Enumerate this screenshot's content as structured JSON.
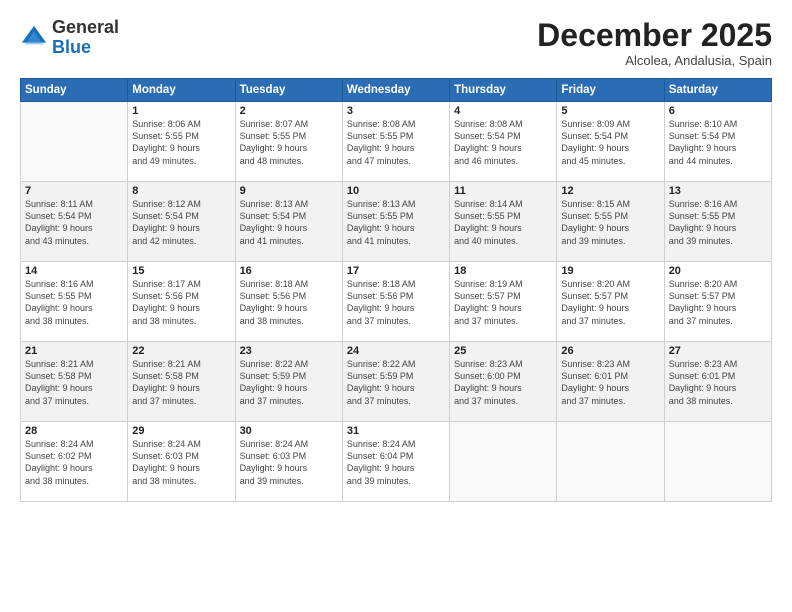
{
  "logo": {
    "general": "General",
    "blue": "Blue"
  },
  "header": {
    "month": "December 2025",
    "location": "Alcolea, Andalusia, Spain"
  },
  "weekdays": [
    "Sunday",
    "Monday",
    "Tuesday",
    "Wednesday",
    "Thursday",
    "Friday",
    "Saturday"
  ],
  "weeks": [
    [
      {
        "day": "",
        "info": ""
      },
      {
        "day": "1",
        "info": "Sunrise: 8:06 AM\nSunset: 5:55 PM\nDaylight: 9 hours\nand 49 minutes."
      },
      {
        "day": "2",
        "info": "Sunrise: 8:07 AM\nSunset: 5:55 PM\nDaylight: 9 hours\nand 48 minutes."
      },
      {
        "day": "3",
        "info": "Sunrise: 8:08 AM\nSunset: 5:55 PM\nDaylight: 9 hours\nand 47 minutes."
      },
      {
        "day": "4",
        "info": "Sunrise: 8:08 AM\nSunset: 5:54 PM\nDaylight: 9 hours\nand 46 minutes."
      },
      {
        "day": "5",
        "info": "Sunrise: 8:09 AM\nSunset: 5:54 PM\nDaylight: 9 hours\nand 45 minutes."
      },
      {
        "day": "6",
        "info": "Sunrise: 8:10 AM\nSunset: 5:54 PM\nDaylight: 9 hours\nand 44 minutes."
      }
    ],
    [
      {
        "day": "7",
        "info": "Sunrise: 8:11 AM\nSunset: 5:54 PM\nDaylight: 9 hours\nand 43 minutes."
      },
      {
        "day": "8",
        "info": "Sunrise: 8:12 AM\nSunset: 5:54 PM\nDaylight: 9 hours\nand 42 minutes."
      },
      {
        "day": "9",
        "info": "Sunrise: 8:13 AM\nSunset: 5:54 PM\nDaylight: 9 hours\nand 41 minutes."
      },
      {
        "day": "10",
        "info": "Sunrise: 8:13 AM\nSunset: 5:55 PM\nDaylight: 9 hours\nand 41 minutes."
      },
      {
        "day": "11",
        "info": "Sunrise: 8:14 AM\nSunset: 5:55 PM\nDaylight: 9 hours\nand 40 minutes."
      },
      {
        "day": "12",
        "info": "Sunrise: 8:15 AM\nSunset: 5:55 PM\nDaylight: 9 hours\nand 39 minutes."
      },
      {
        "day": "13",
        "info": "Sunrise: 8:16 AM\nSunset: 5:55 PM\nDaylight: 9 hours\nand 39 minutes."
      }
    ],
    [
      {
        "day": "14",
        "info": "Sunrise: 8:16 AM\nSunset: 5:55 PM\nDaylight: 9 hours\nand 38 minutes."
      },
      {
        "day": "15",
        "info": "Sunrise: 8:17 AM\nSunset: 5:56 PM\nDaylight: 9 hours\nand 38 minutes."
      },
      {
        "day": "16",
        "info": "Sunrise: 8:18 AM\nSunset: 5:56 PM\nDaylight: 9 hours\nand 38 minutes."
      },
      {
        "day": "17",
        "info": "Sunrise: 8:18 AM\nSunset: 5:56 PM\nDaylight: 9 hours\nand 37 minutes."
      },
      {
        "day": "18",
        "info": "Sunrise: 8:19 AM\nSunset: 5:57 PM\nDaylight: 9 hours\nand 37 minutes."
      },
      {
        "day": "19",
        "info": "Sunrise: 8:20 AM\nSunset: 5:57 PM\nDaylight: 9 hours\nand 37 minutes."
      },
      {
        "day": "20",
        "info": "Sunrise: 8:20 AM\nSunset: 5:57 PM\nDaylight: 9 hours\nand 37 minutes."
      }
    ],
    [
      {
        "day": "21",
        "info": "Sunrise: 8:21 AM\nSunset: 5:58 PM\nDaylight: 9 hours\nand 37 minutes."
      },
      {
        "day": "22",
        "info": "Sunrise: 8:21 AM\nSunset: 5:58 PM\nDaylight: 9 hours\nand 37 minutes."
      },
      {
        "day": "23",
        "info": "Sunrise: 8:22 AM\nSunset: 5:59 PM\nDaylight: 9 hours\nand 37 minutes."
      },
      {
        "day": "24",
        "info": "Sunrise: 8:22 AM\nSunset: 5:59 PM\nDaylight: 9 hours\nand 37 minutes."
      },
      {
        "day": "25",
        "info": "Sunrise: 8:23 AM\nSunset: 6:00 PM\nDaylight: 9 hours\nand 37 minutes."
      },
      {
        "day": "26",
        "info": "Sunrise: 8:23 AM\nSunset: 6:01 PM\nDaylight: 9 hours\nand 37 minutes."
      },
      {
        "day": "27",
        "info": "Sunrise: 8:23 AM\nSunset: 6:01 PM\nDaylight: 9 hours\nand 38 minutes."
      }
    ],
    [
      {
        "day": "28",
        "info": "Sunrise: 8:24 AM\nSunset: 6:02 PM\nDaylight: 9 hours\nand 38 minutes."
      },
      {
        "day": "29",
        "info": "Sunrise: 8:24 AM\nSunset: 6:03 PM\nDaylight: 9 hours\nand 38 minutes."
      },
      {
        "day": "30",
        "info": "Sunrise: 8:24 AM\nSunset: 6:03 PM\nDaylight: 9 hours\nand 39 minutes."
      },
      {
        "day": "31",
        "info": "Sunrise: 8:24 AM\nSunset: 6:04 PM\nDaylight: 9 hours\nand 39 minutes."
      },
      {
        "day": "",
        "info": ""
      },
      {
        "day": "",
        "info": ""
      },
      {
        "day": "",
        "info": ""
      }
    ]
  ]
}
